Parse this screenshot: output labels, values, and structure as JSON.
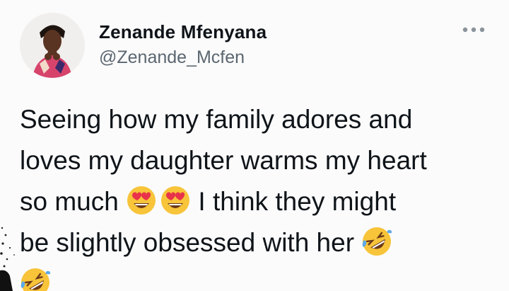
{
  "user": {
    "name": "Zenande Mfenyana",
    "handle": "@Zenande_Mcfen",
    "avatar_icon": "profile-photo-avatar"
  },
  "more_icon": "more-horizontal-icon",
  "tweet": {
    "lines": [
      {
        "text": "Seeing how my family adores and"
      },
      {
        "text": "loves my daughter warms my heart"
      },
      {
        "before": "so much",
        "after": "I think they might",
        "emojis": [
          "smiling-face-heart-eyes",
          "smiling-face-heart-eyes"
        ]
      },
      {
        "text": "be slightly obsessed with her",
        "emoji": "rolling-on-floor-laughing"
      },
      {
        "emoji": "rolling-on-floor-laughing"
      }
    ]
  },
  "colors": {
    "text": "#0f1419",
    "secondary": "#5b6670",
    "background": "#fbfbfb",
    "emoji_yellow": "#f7c43a",
    "heart_red": "#e8334a",
    "tear_blue": "#5da9e9"
  }
}
